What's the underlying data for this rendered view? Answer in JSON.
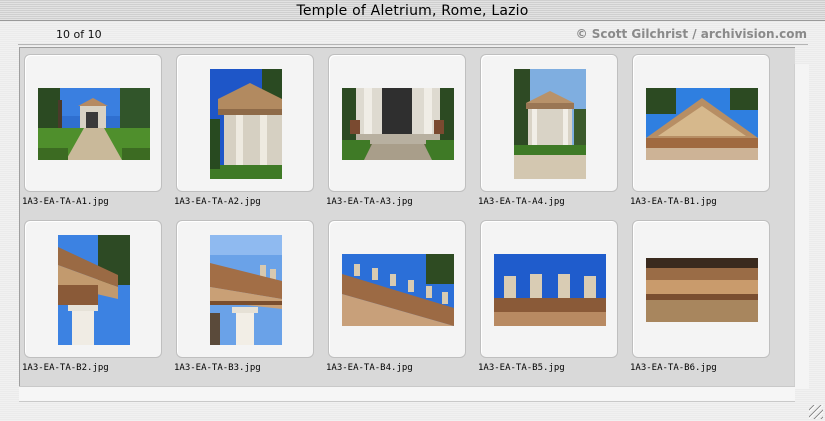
{
  "window": {
    "title": "Temple of Aletrium, Rome, Lazio"
  },
  "header": {
    "counter": "10 of 10",
    "copyright": "© Scott Gilchrist / archivision.com"
  },
  "thumbnails": [
    {
      "filename": "1A3-EA-TA-A1.jpg"
    },
    {
      "filename": "1A3-EA-TA-A2.jpg"
    },
    {
      "filename": "1A3-EA-TA-A3.jpg"
    },
    {
      "filename": "1A3-EA-TA-A4.jpg"
    },
    {
      "filename": "1A3-EA-TA-B1.jpg"
    },
    {
      "filename": "1A3-EA-TA-B2.jpg"
    },
    {
      "filename": "1A3-EA-TA-B3.jpg"
    },
    {
      "filename": "1A3-EA-TA-B4.jpg"
    },
    {
      "filename": "1A3-EA-TA-B5.jpg"
    },
    {
      "filename": "1A3-EA-TA-B6.jpg"
    }
  ]
}
